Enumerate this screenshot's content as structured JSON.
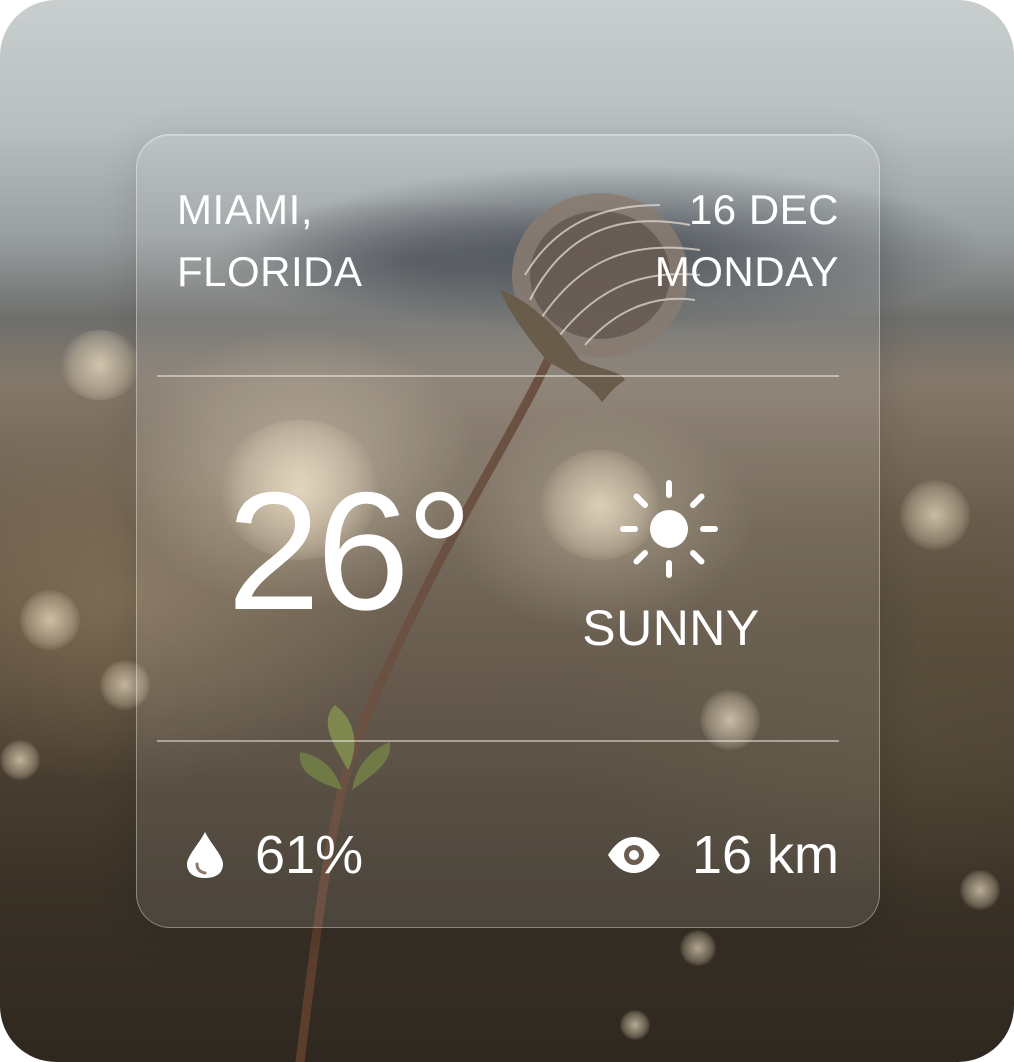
{
  "weather": {
    "location": {
      "city": "MIAMI,",
      "region": "FLORIDA"
    },
    "date": {
      "day_month": "16 DEC",
      "weekday": "MONDAY"
    },
    "temperature": "26°",
    "condition": "SUNNY",
    "condition_icon": "sun-icon",
    "humidity": {
      "icon": "droplet-icon",
      "value": "61%"
    },
    "visibility": {
      "icon": "eye-icon",
      "value": "16 km"
    }
  },
  "colors": {
    "text": "#ffffff",
    "card_glass": "rgba(255,255,255,0.10)",
    "card_border": "rgba(255,255,255,0.35)"
  }
}
